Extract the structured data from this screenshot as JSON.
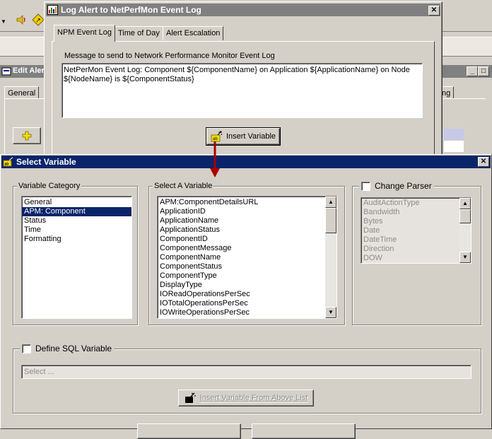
{
  "bg": {
    "edit_window_title": "Edit Aler",
    "tab_general": "General",
    "tab_right": "ng"
  },
  "log_dialog": {
    "title": "Log Alert to NetPerfMon Event Log",
    "tabs": [
      "NPM Event Log",
      "Time of Day",
      "Alert Escalation"
    ],
    "message_label": "Message to send to Network Performance Monitor Event Log",
    "message_text": "NetPerMon Event Log:  Component  ${ComponentName} on Application ${ApplicationName} on Node ${NodeName} is ${ComponentStatus}",
    "insert_button": "Insert Variable"
  },
  "select_variable": {
    "title": "Select Variable",
    "category_label": "Variable Category",
    "categories": [
      "General",
      "APM: Component",
      "Status",
      "Time",
      "Formatting"
    ],
    "selected_category": "APM: Component",
    "variable_label": "Select A Variable",
    "variables": [
      "APM:ComponentDetailsURL",
      "ApplicationID",
      "ApplicationName",
      "ApplicationStatus",
      "ComponentID",
      "ComponentMessage",
      "ComponentName",
      "ComponentStatus",
      "ComponentType",
      "DisplayType",
      "IOReadOperationsPerSec",
      "IOTotalOperationsPerSec",
      "IOWriteOperationsPerSec"
    ],
    "change_parser_label": "Change Parser",
    "parsers": [
      "AuditActionType",
      "Bandwidth",
      "Bytes",
      "Date",
      "DateTime",
      "Direction",
      "DOW"
    ],
    "define_sql_label": "Define SQL Variable",
    "sql_select_placeholder": "Select ...",
    "insert_from_list_button": "Insert Variable From Above List"
  },
  "colors": {
    "title_active": "#0a246a",
    "title_inactive": "#808080",
    "arrow": "#c00000",
    "face": "#d4d0c8"
  }
}
